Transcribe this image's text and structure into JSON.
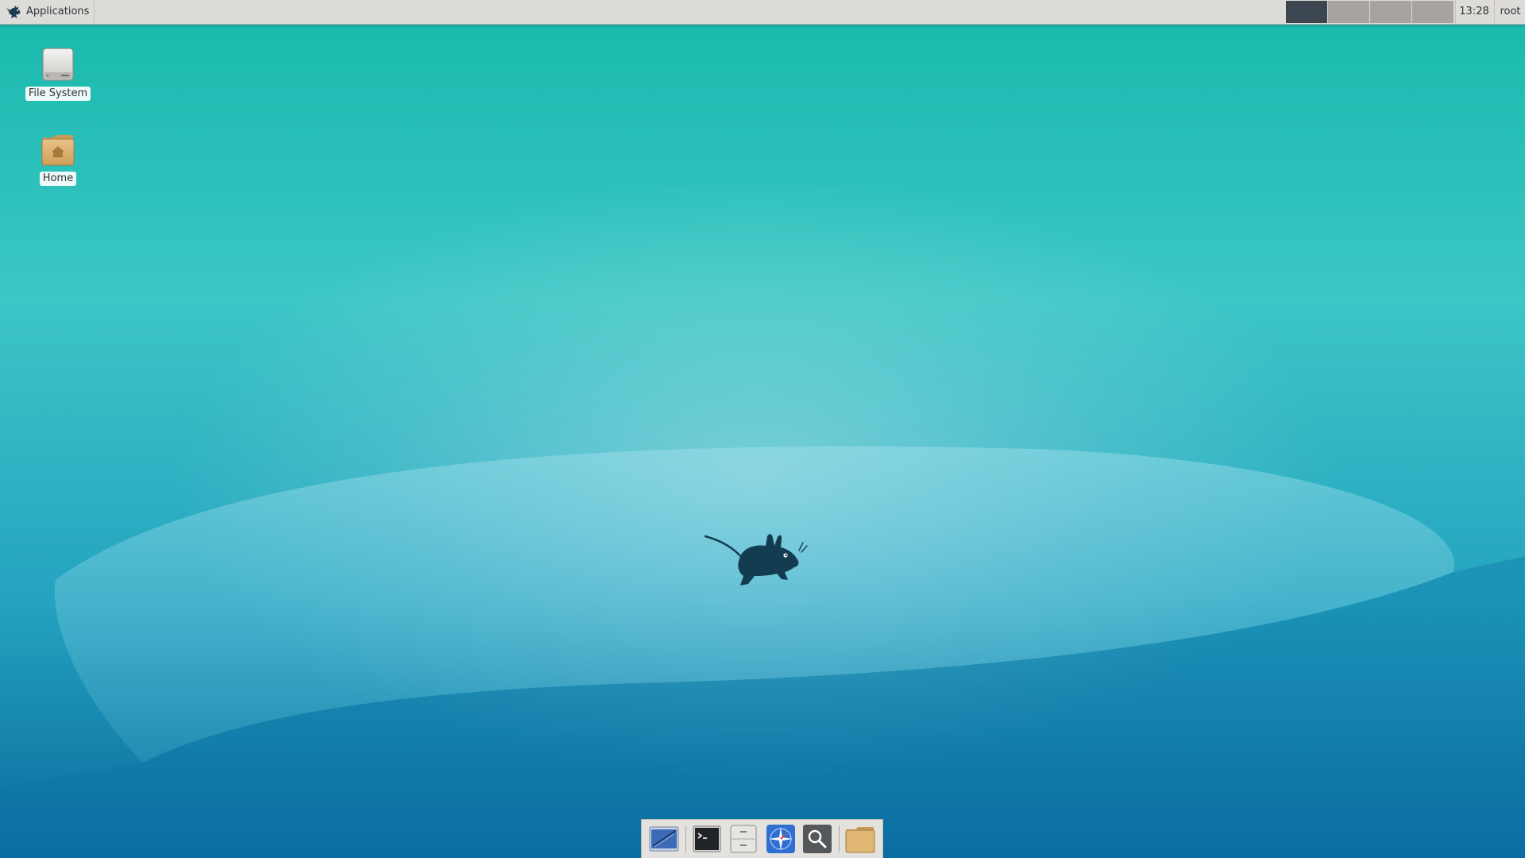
{
  "top_panel": {
    "applications_label": "Applications",
    "applications_icon": "xfce-mouse-icon",
    "workspaces": [
      {
        "active": true
      },
      {
        "active": false
      },
      {
        "active": false
      },
      {
        "active": false
      }
    ],
    "clock": "13:28",
    "user": "root"
  },
  "desktop_icons": [
    {
      "label": "File System",
      "icon": "drive-icon"
    },
    {
      "label": "Home",
      "icon": "home-folder-icon"
    }
  ],
  "dock": {
    "items": [
      {
        "icon": "show-desktop-icon"
      },
      {
        "icon": "terminal-icon"
      },
      {
        "icon": "file-manager-icon"
      },
      {
        "icon": "web-browser-icon"
      },
      {
        "icon": "app-finder-search-icon"
      },
      {
        "icon": "folder-icon"
      }
    ]
  },
  "colors": {
    "wallpaper_top": "#1ab3b0",
    "wallpaper_bottom": "#0b6fa0",
    "panel": "#dedcd9",
    "workspace_active": "#3b4650",
    "workspace_inactive": "#a8a39e",
    "mouse_logo": "#143c50"
  }
}
